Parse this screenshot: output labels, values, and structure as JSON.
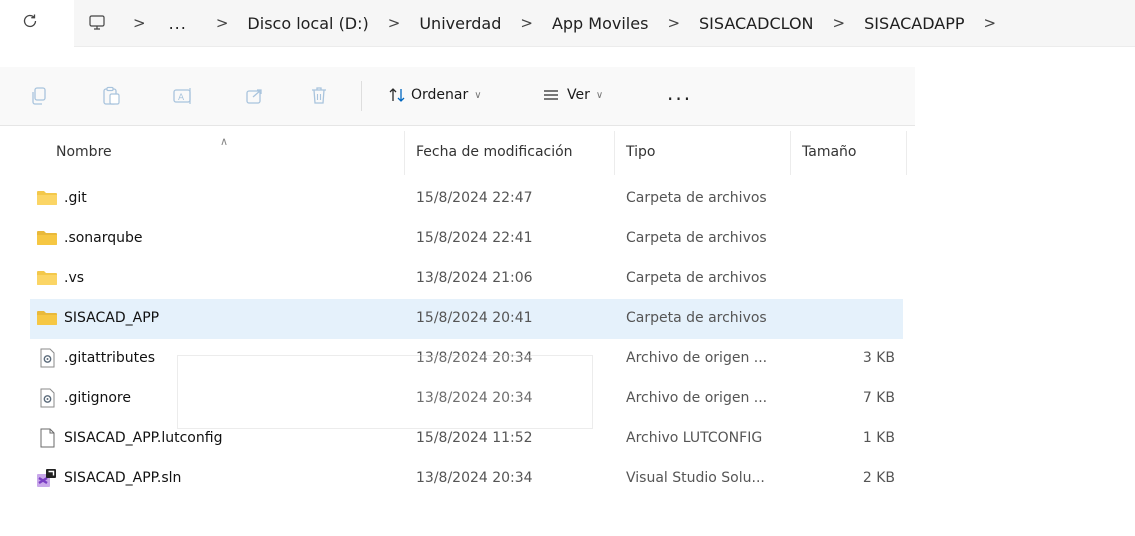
{
  "address_bar": {
    "ellipsis": "...",
    "breadcrumbs": [
      "Disco local (D:)",
      "Univerdad",
      "App Moviles",
      "SISACADCLON",
      "SISACADAPP"
    ]
  },
  "command_bar": {
    "sort_label": "Ordenar",
    "view_label": "Ver",
    "more_label": "..."
  },
  "columns": {
    "name": "Nombre",
    "date": "Fecha de modificación",
    "type": "Tipo",
    "size": "Tamaño"
  },
  "files": [
    {
      "name": ".git",
      "date": "15/8/2024 22:47",
      "type": "Carpeta de archivos",
      "size": "",
      "icon": "folder-icon"
    },
    {
      "name": ".sonarqube",
      "date": "15/8/2024 22:41",
      "type": "Carpeta de archivos",
      "size": "",
      "icon": "folder-icon"
    },
    {
      "name": ".vs",
      "date": "13/8/2024 21:06",
      "type": "Carpeta de archivos",
      "size": "",
      "icon": "folder-icon"
    },
    {
      "name": "SISACAD_APP",
      "date": "15/8/2024 20:41",
      "type": "Carpeta de archivos",
      "size": "",
      "icon": "folder-icon",
      "selected": true
    },
    {
      "name": ".gitattributes",
      "date": "13/8/2024 20:34",
      "type": "Archivo de origen ...",
      "size": "3 KB",
      "icon": "config-file-icon"
    },
    {
      "name": ".gitignore",
      "date": "13/8/2024 20:34",
      "type": "Archivo de origen ...",
      "size": "7 KB",
      "icon": "config-file-icon"
    },
    {
      "name": "SISACAD_APP.lutconfig",
      "date": "15/8/2024 11:52",
      "type": "Archivo LUTCONFIG",
      "size": "1 KB",
      "icon": "file-icon"
    },
    {
      "name": "SISACAD_APP.sln",
      "date": "13/8/2024 20:34",
      "type": "Visual Studio Solu...",
      "size": "2 KB",
      "icon": "visual-studio-solution-icon"
    }
  ],
  "colors": {
    "folder": "#f3c84b",
    "selected_row": "#e5f1fb",
    "accent": "#0067c0"
  }
}
